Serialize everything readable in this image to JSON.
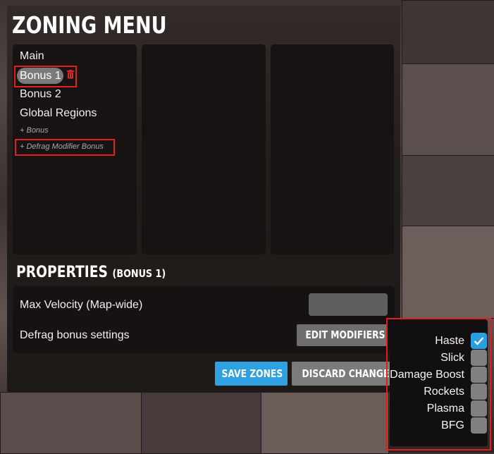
{
  "title": "ZONING MENU",
  "zones": {
    "items": [
      "Main",
      "Bonus 1",
      "Bonus 2",
      "Global Regions"
    ],
    "selected": "Bonus 1",
    "add_bonus": "+ Bonus",
    "add_defrag": "+ Defrag Modifier Bonus"
  },
  "properties": {
    "title": "PROPERTIES",
    "subtitle": "(BONUS 1)",
    "max_velocity_label": "Max Velocity (Map-wide)",
    "max_velocity_value": "",
    "defrag_label": "Defrag bonus settings",
    "edit_modifiers": "EDIT MODIFIERS"
  },
  "buttons": {
    "save": "SAVE ZONES",
    "discard": "DISCARD CHANGES"
  },
  "modifiers": [
    {
      "label": "Haste",
      "checked": true
    },
    {
      "label": "Slick",
      "checked": false
    },
    {
      "label": "Damage Boost",
      "checked": false
    },
    {
      "label": "Rockets",
      "checked": false
    },
    {
      "label": "Plasma",
      "checked": false
    },
    {
      "label": "BFG",
      "checked": false
    }
  ],
  "colors": {
    "accent": "#2fa0e0",
    "highlight_box": "#e02020"
  }
}
